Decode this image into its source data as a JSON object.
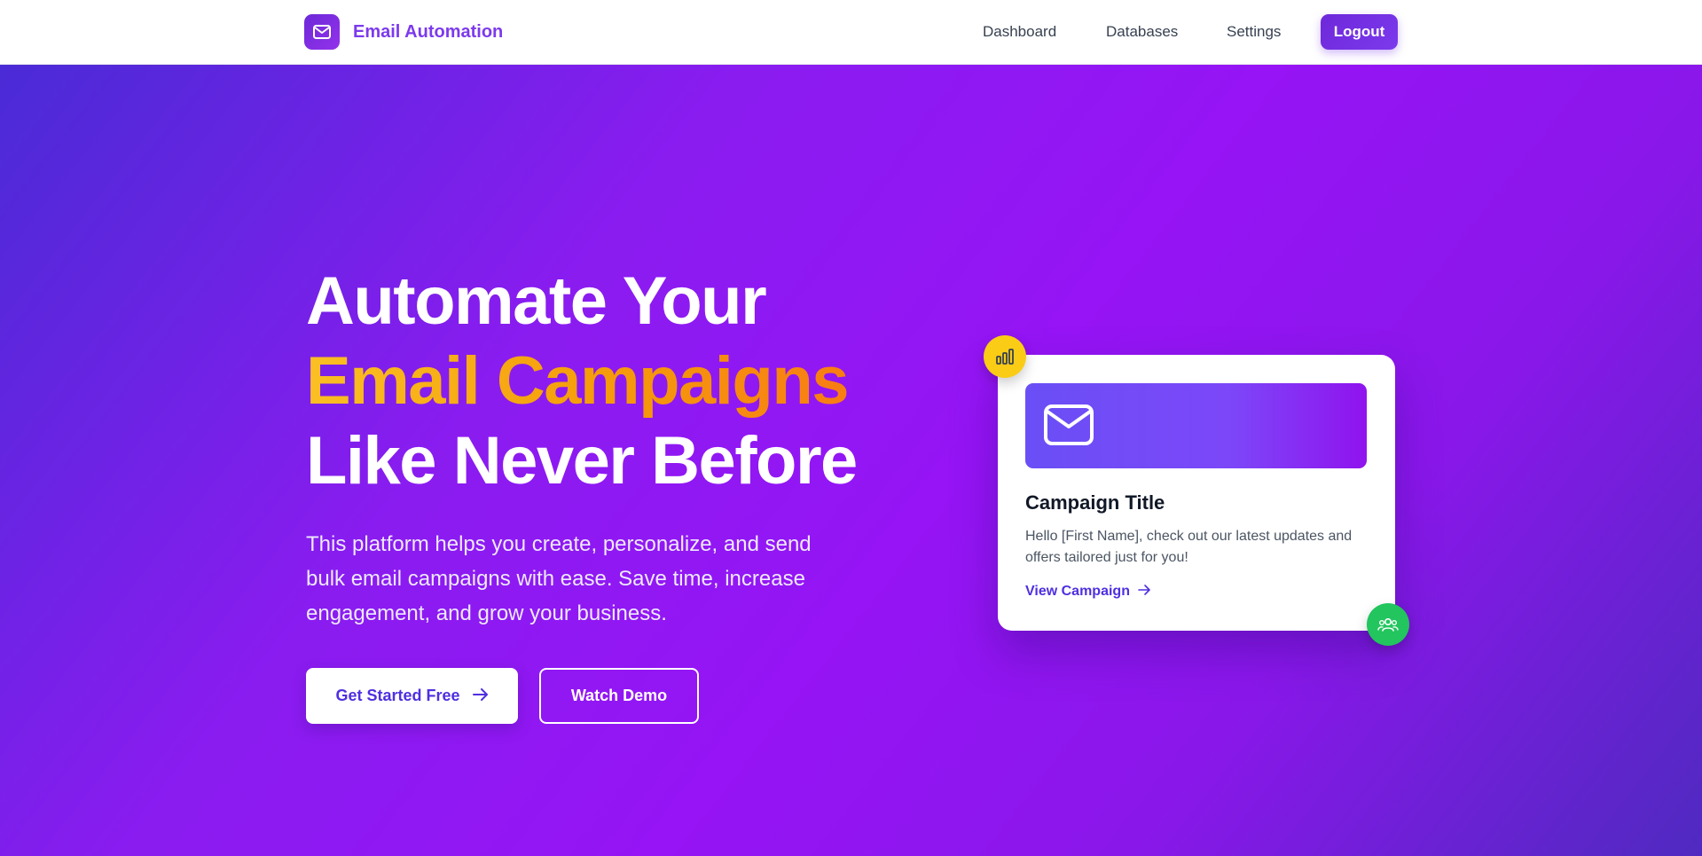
{
  "header": {
    "brand_name": "Email Automation",
    "nav": {
      "dashboard": "Dashboard",
      "databases": "Databases",
      "settings": "Settings"
    },
    "logout_label": "Logout"
  },
  "hero": {
    "title_line1": "Automate Your",
    "title_line2": "Email Campaigns",
    "title_line3": "Like Never Before",
    "description": "This platform helps you create, personalize, and send bulk email campaigns with ease. Save time, increase engagement, and grow your business.",
    "primary_cta": "Get Started Free",
    "secondary_cta": "Watch Demo"
  },
  "preview_card": {
    "title": "Campaign Title",
    "body": "Hello [First Name], check out our latest updates and offers tailored just for you!",
    "link_label": "View Campaign"
  },
  "colors": {
    "brand": "#7c3aed",
    "hero_gradient_start": "#4a2bd6",
    "hero_gradient_mid": "#9614f5",
    "accent_text_start": "#fbbf24",
    "accent_text_end": "#f97316",
    "badge_chart": "#facc15",
    "badge_users": "#22c55e"
  },
  "icons": {
    "brand_logo": "mail-icon",
    "primary_cta": "arrow-right-icon",
    "card_banner": "mail-icon",
    "card_link": "arrow-right-icon",
    "badge_chart": "bar-chart-icon",
    "badge_users": "users-icon"
  }
}
